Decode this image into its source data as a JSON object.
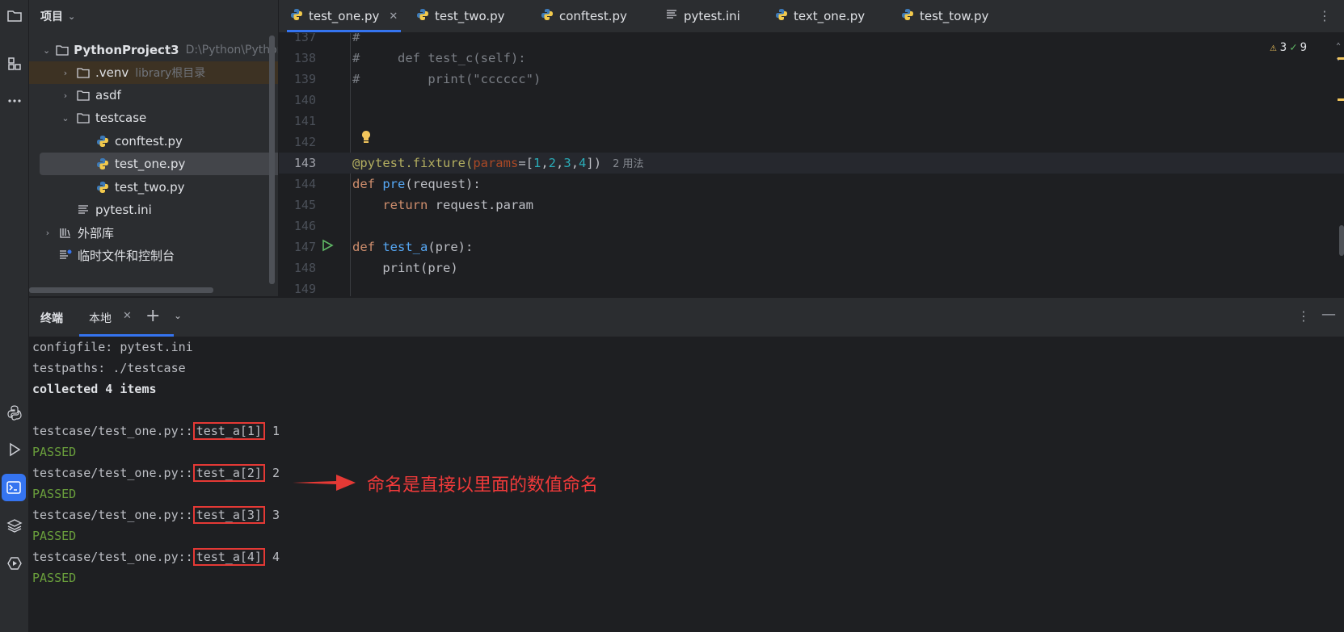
{
  "project_panel": {
    "title": "项目",
    "items": [
      {
        "label": "PythonProject3",
        "path": "D:\\Python\\PythonP",
        "kind": "root"
      },
      {
        "label": ".venv",
        "note": "library根目录",
        "kind": "folder"
      },
      {
        "label": "asdf",
        "kind": "folder"
      },
      {
        "label": "testcase",
        "kind": "folder"
      },
      {
        "label": "conftest.py",
        "kind": "py"
      },
      {
        "label": "test_one.py",
        "kind": "py"
      },
      {
        "label": "test_two.py",
        "kind": "py"
      },
      {
        "label": "pytest.ini",
        "kind": "ini"
      },
      {
        "label": "外部库",
        "kind": "lib"
      },
      {
        "label": "临时文件和控制台",
        "kind": "scratch"
      }
    ]
  },
  "editor": {
    "tabs": [
      "test_one.py",
      "test_two.py",
      "conftest.py",
      "pytest.ini",
      "text_one.py",
      "test_tow.py"
    ],
    "inspections": {
      "warnings": "3",
      "ok": "9"
    },
    "lines": [
      {
        "n": "137",
        "text": "#"
      },
      {
        "n": "138",
        "text": "#     def test_c(self):"
      },
      {
        "n": "139",
        "text": "#         print(\"cccccc\")"
      },
      {
        "n": "140",
        "text": ""
      },
      {
        "n": "141",
        "text": ""
      },
      {
        "n": "142",
        "text": ""
      },
      {
        "n": "143",
        "deco": "@pytest.fixture(",
        "param": "params",
        "eq": "=[",
        "nums": [
          "1",
          "2",
          "3",
          "4"
        ],
        "close": "])",
        "hint": "2 用法"
      },
      {
        "n": "144",
        "kw": "def ",
        "fn": "pre",
        "rest": "(request):"
      },
      {
        "n": "145",
        "indent": "    ",
        "kw": "return ",
        "rest": "request.param"
      },
      {
        "n": "146",
        "text": ""
      },
      {
        "n": "147",
        "kw": "def ",
        "fn": "test_a",
        "rest": "(pre):"
      },
      {
        "n": "148",
        "indent": "    ",
        "rest": "print(pre)"
      },
      {
        "n": "149",
        "text": ""
      }
    ]
  },
  "terminal": {
    "title": "终端",
    "tab": "本地",
    "lines": {
      "configfile": "configfile: pytest.ini",
      "testpaths": "testpaths: ./testcase",
      "collected": "collected 4 items",
      "prefix": "testcase/test_one.py::",
      "tests": [
        {
          "name": "test_a[1]",
          "out": " 1",
          "status": "PASSED"
        },
        {
          "name": "test_a[2]",
          "out": " 2",
          "status": "PASSED"
        },
        {
          "name": "test_a[3]",
          "out": " 3",
          "status": "PASSED"
        },
        {
          "name": "test_a[4]",
          "out": " 4",
          "status": "PASSED"
        }
      ]
    }
  },
  "annotation": {
    "text": "命名是直接以里面的数值命名",
    "color": "#f03a3a"
  },
  "colors": {
    "accent": "#3574f0",
    "passed": "#6a9f3c",
    "highlight_box": "#e53935"
  }
}
